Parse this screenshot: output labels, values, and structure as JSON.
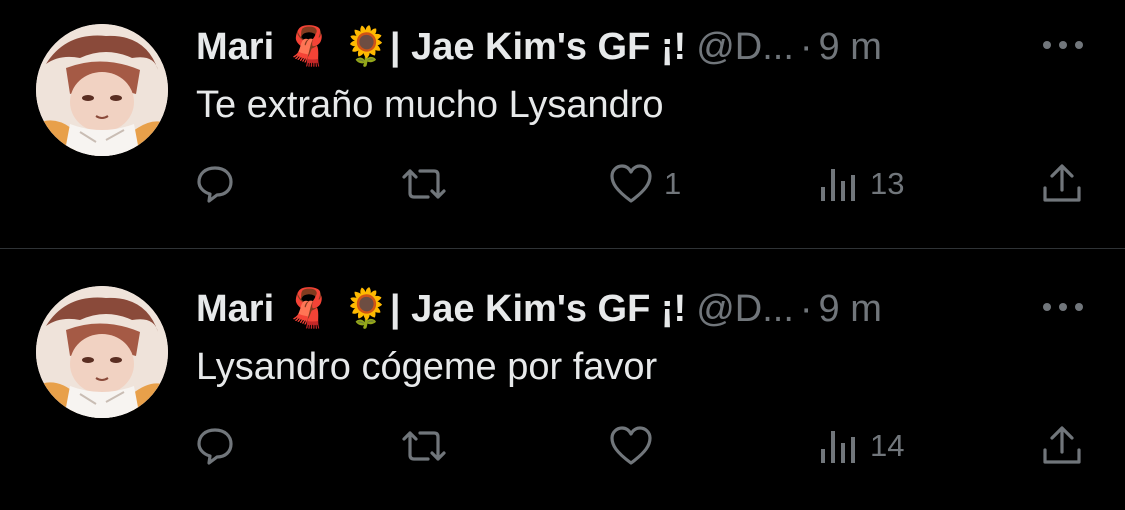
{
  "colors": {
    "background": "#000000",
    "primary_text": "#e7e9ea",
    "secondary_text": "#71767b",
    "divider": "#2f3336"
  },
  "icons": [
    "reply-icon",
    "retweet-icon",
    "like-icon",
    "views-icon",
    "share-icon",
    "more-icon"
  ],
  "tweets": [
    {
      "display_name": "Mari 🧣 🌻| Jae Kim's GF ¡!",
      "handle": "@D...",
      "separator": "·",
      "time": "9 m",
      "text": "Te extraño mucho Lysandro",
      "likes": "1",
      "views": "13"
    },
    {
      "display_name": "Mari 🧣 🌻| Jae Kim's GF ¡!",
      "handle": "@D...",
      "separator": "·",
      "time": "9 m",
      "text": "Lysandro cógeme por favor",
      "likes": "",
      "views": "14"
    }
  ]
}
